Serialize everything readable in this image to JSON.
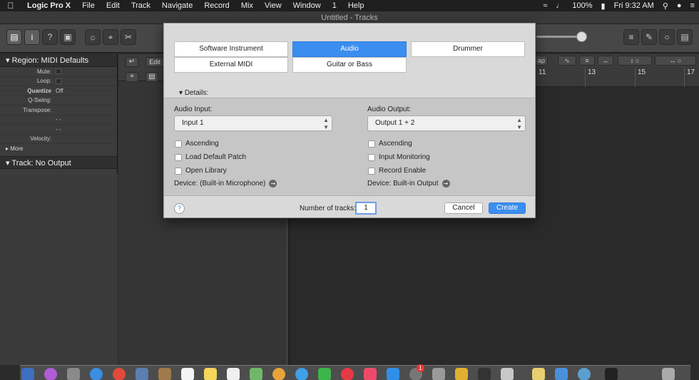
{
  "menubar": {
    "app": "Logic Pro X",
    "items": [
      "File",
      "Edit",
      "Track",
      "Navigate",
      "Record",
      "Mix",
      "View",
      "Window",
      "1",
      "Help"
    ],
    "battery": "100%",
    "clock": "Fri 9:32 AM"
  },
  "window": {
    "title": "Untitled - Tracks"
  },
  "inspector": {
    "region_header": "Region: MIDI Defaults",
    "rows": [
      {
        "label": "Mute:",
        "value": ""
      },
      {
        "label": "Loop:",
        "value": ""
      },
      {
        "label": "Quantize",
        "value": "Off"
      },
      {
        "label": "Q-Swing:",
        "value": ""
      },
      {
        "label": "Transpose:",
        "value": ""
      },
      {
        "label": "",
        "value": "-  -"
      },
      {
        "label": "",
        "value": "-  -"
      },
      {
        "label": "Velocity:",
        "value": ""
      }
    ],
    "more": "More",
    "track_header": "Track:  No Output"
  },
  "trackarea": {
    "edit_label": "Edit",
    "add_label": "+"
  },
  "mainbar": {
    "snap_label": "ap"
  },
  "ruler": {
    "marks": [
      "11",
      "13",
      "15",
      "17"
    ]
  },
  "dialog": {
    "types": [
      "Software Instrument",
      "Audio",
      "Drummer",
      "External MIDI",
      "Guitar or Bass"
    ],
    "details_label": "Details:",
    "audio_input_label": "Audio Input:",
    "audio_input_value": "Input 1",
    "audio_output_label": "Audio Output:",
    "audio_output_value": "Output 1 + 2",
    "left_checks": [
      "Ascending",
      "Load Default Patch",
      "Open Library"
    ],
    "right_checks": [
      "Ascending",
      "Input Monitoring",
      "Record Enable"
    ],
    "left_device": "Device: (Built-in Microphone)",
    "right_device": "Device: Built-in Output",
    "help": "?",
    "num_tracks_label": "Number of tracks:",
    "num_tracks_value": "1",
    "cancel_label": "Cancel",
    "create_label": "Create"
  },
  "dock": {
    "badge": "1"
  }
}
